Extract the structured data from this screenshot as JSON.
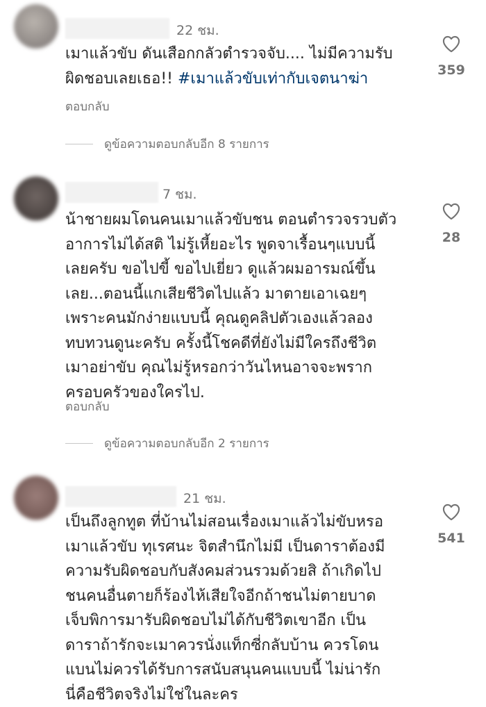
{
  "comments": [
    {
      "time": "22 ชม.",
      "text": "เมาแล้วขับ ดันเสือกกลัวตำรวจจับ.... ไม่มีความรับ\nผิดชอบเลยเธอ!! ",
      "hashtag": "#เมาแล้วขับเท่ากับเจตนาฆ่า",
      "reply_label": "ตอบกลับ",
      "view_replies_label": "ดูข้อความตอบกลับอีก 8 รายการ",
      "likes": "359"
    },
    {
      "time": "7 ชม.",
      "text": "น้าชายผมโดนคนเมาแล้วขับชน ตอนตำรวจรวบตัว\nอาการไม่ได้สติ ไม่รู้เหี้ยอะไร พูดจาเรื้อนๆแบบนี้\nเลยครับ ขอไปขี้ ขอไปเยี่ยว ดูแล้วผมอารมณ์ขึ้น\nเลย...ตอนนี้แกเสียชีวิตไปแล้ว มาตายเอาเฉยๆ\nเพราะคนมักง่ายแบบนี้ คุณดูคลิปตัวเองแล้วลอง\nทบทวนดูนะครับ ครั้งนี้โชคดีที่ยังไม่มีใครถึงชีวิต\nเมาอย่าขับ คุณไม่รู้หรอกว่าวันไหนอาจจะพราก\nครอบครัวของใครไป.",
      "reply_label": "ตอบกลับ",
      "view_replies_label": "ดูข้อความตอบกลับอีก 2 รายการ",
      "likes": "28"
    },
    {
      "time": "21 ชม.",
      "text": "เป็นถึงลูกทูต ที่บ้านไม่สอนเรื่องเมาแล้วไม่ขับหรอ\nเมาแล้วขับ ทุเรศนะ จิตสำนึกไม่มี เป็นดาราต้องมี\nความรับผิดชอบกับสังคมส่วนรวมด้วยสิ ถ้าเกิดไป\nชนคนอื่นตายก็ร้องไห้เสียใจอีกถ้าชนไม่ตายบาด\nเจ็บพิการมารับผิดชอบไม่ได้กับชีวิตเขาอีก เป็น\nดาราถ้ารักจะเมาควรนั่งแท็กซี่กลับบ้าน ควรโดน\nแบนไม่ควรได้รับการสนับสนุนคนแบบนี้ ไม่น่ารัก\nนี่คือชีวิตจริงไม่ใช่ในละคร",
      "likes": "541"
    }
  ],
  "icons": {
    "like": "heart-outline-icon"
  },
  "colors": {
    "text": "#262626",
    "secondary": "#737373",
    "hashtag": "#00376b"
  }
}
